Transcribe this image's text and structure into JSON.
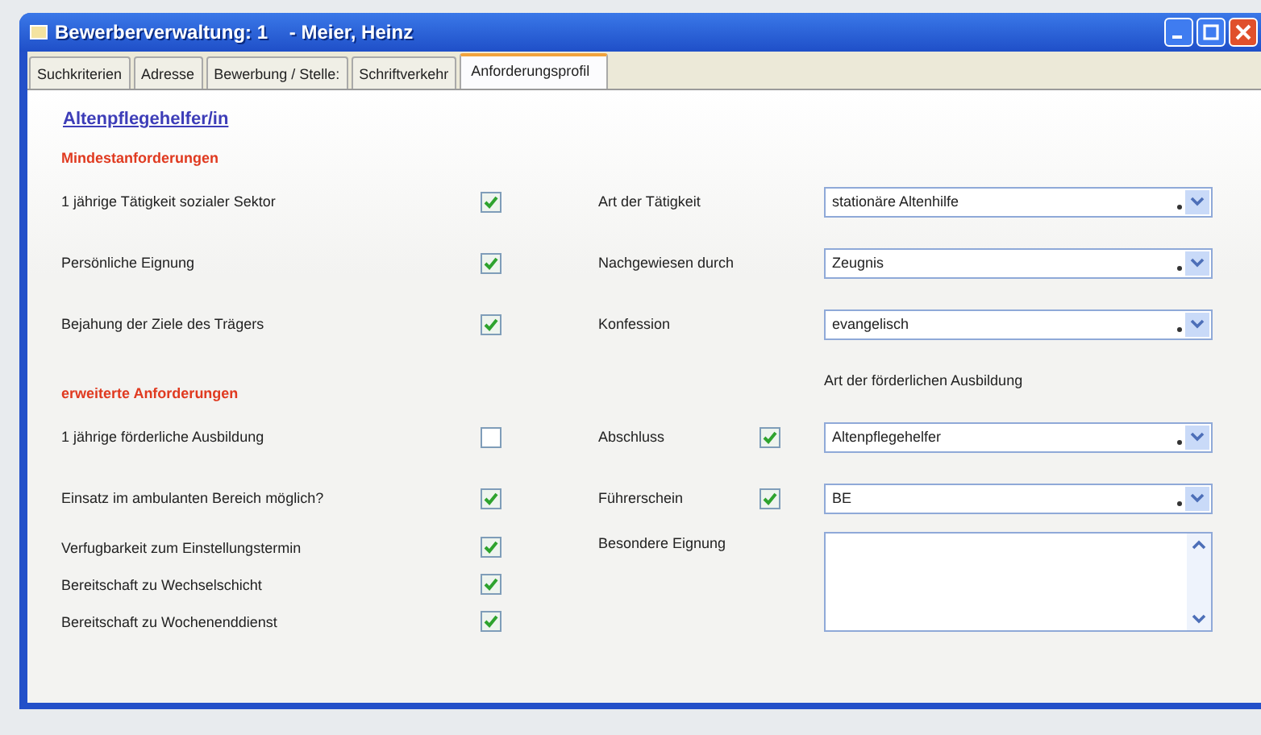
{
  "window": {
    "title": "Bewerberverwaltung: 1    - Meier, Heinz"
  },
  "tabs": [
    {
      "label": "Suchkriterien",
      "selected": false
    },
    {
      "label": "Adresse",
      "selected": false
    },
    {
      "label": "Bewerbung / Stelle:",
      "selected": false
    },
    {
      "label": "Schriftverkehr",
      "selected": false
    },
    {
      "label": "Anforderungsprofil",
      "selected": true
    }
  ],
  "profile_title": "Altenpflegehelfer/in",
  "sections": [
    {
      "heading": "Mindestanforderungen",
      "rows": [
        {
          "label": "1 jährige Tätigkeit sozialer Sektor",
          "checked": true,
          "field": {
            "kind": "combo",
            "label": "Art der Tätigkeit",
            "value": "stationäre Altenhilfe"
          }
        },
        {
          "label": "Persönliche Eignung",
          "checked": true,
          "field": {
            "kind": "combo",
            "label": "Nachgewiesen durch",
            "value": "Zeugnis"
          }
        },
        {
          "label": "Bejahung der Ziele des Trägers",
          "checked": true,
          "field": {
            "kind": "combo",
            "label": "Konfession",
            "value": "evangelisch"
          }
        }
      ]
    },
    {
      "heading": "erweiterte Anforderungen",
      "caption": "Art der förderlichen Ausbildung",
      "rows": [
        {
          "label": "1 jährige förderliche Ausbildung",
          "checked": false,
          "field": {
            "kind": "combo",
            "label": "Abschluss",
            "checked": true,
            "value": "Altenpflegehelfer"
          }
        },
        {
          "label": "Einsatz im ambulanten Bereich möglich?",
          "checked": true,
          "field": {
            "kind": "combo",
            "label": "Führerschein",
            "checked": true,
            "value": "BE"
          }
        },
        {
          "label": "Verfugbarkeit zum Einstellungstermin",
          "checked": true,
          "field": {
            "kind": "textarea",
            "label": "Besondere Eignung"
          }
        },
        {
          "label": "Bereitschaft zu Wechselschicht",
          "checked": true
        },
        {
          "label": "Bereitschaft zu Wochenenddienst",
          "checked": true
        }
      ]
    }
  ]
}
